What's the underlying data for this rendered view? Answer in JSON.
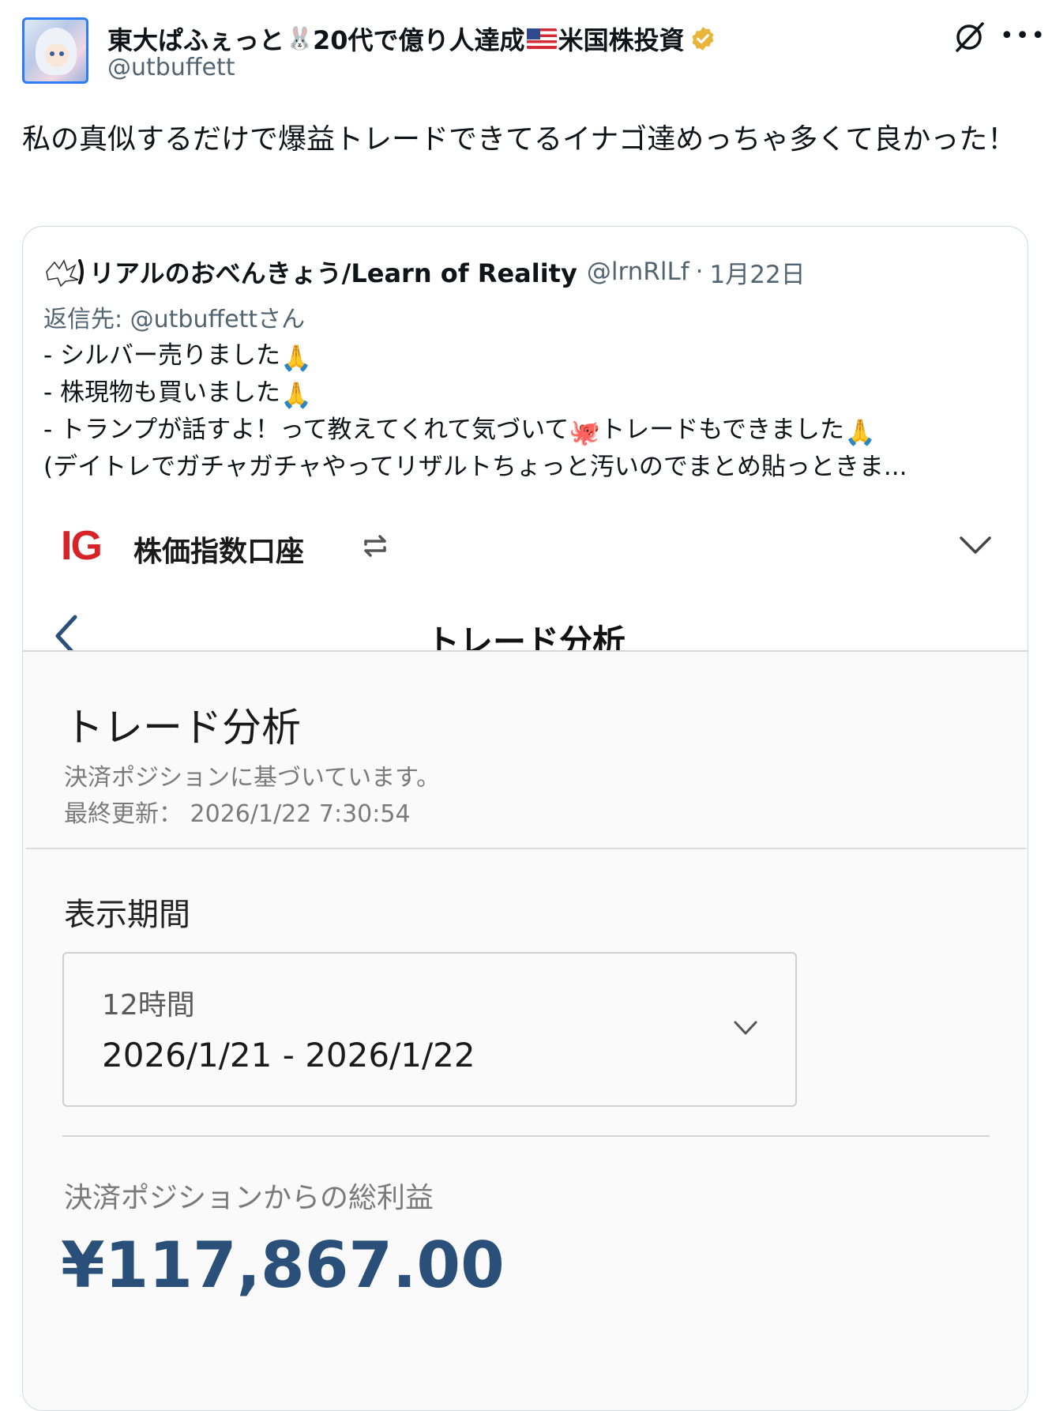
{
  "post": {
    "display_name_part1": "東大ぱふぇっと",
    "display_name_part2": "20代で億り人達成",
    "display_name_part3": "米国株投資",
    "rabbit_emoji": "🐰",
    "handle": "@utbuffett",
    "text": "私の真似するだけで爆益トレードできてるイナゴ達めっちゃ多くて良かった！",
    "verified_color": "#e8b53a",
    "avatar_border_color": "#2e7cf6"
  },
  "quote": {
    "author_name": "リアルのおべんきょう/Learn of Reality",
    "author_handle": "@lrnRlLf",
    "separator": "·",
    "date": "1月22日",
    "reply_to": "返信先: @utbuffettさん",
    "line1": "- シルバー売りました",
    "line2": "- 株現物も買いました",
    "line3a": "- トランプが話すよ！って教えてくれて気づいて",
    "line3b": "トレードもできました",
    "line4": " (デイトレでガチャガチャやってリザルトちょっと汚いのでまとめ貼っときま...",
    "pray_emoji": "🙏",
    "octopus_emoji": "🐙"
  },
  "app": {
    "logo": "IG",
    "account_label": "株価指数口座",
    "nav_title": "トレード分析",
    "panel_title": "トレード分析",
    "panel_subtitle": "決済ポジションに基づいています。",
    "last_updated": "最終更新： 2026/1/22 7:30:54",
    "period_label": "表示期間",
    "period_range": "12時間",
    "period_dates": "2026/1/21 - 2026/1/22",
    "profit_label": "決済ポジションからの総利益",
    "profit_value": "¥117,867.00",
    "brand_color": "#d62327",
    "profit_color": "#2a4f79"
  },
  "icons": {
    "verified": "verified-badge-icon",
    "grok": "grok-icon",
    "more": "more-icon",
    "swap": "swap-account-icon",
    "chevron": "chevron-down-icon",
    "back": "back-chevron-icon"
  }
}
